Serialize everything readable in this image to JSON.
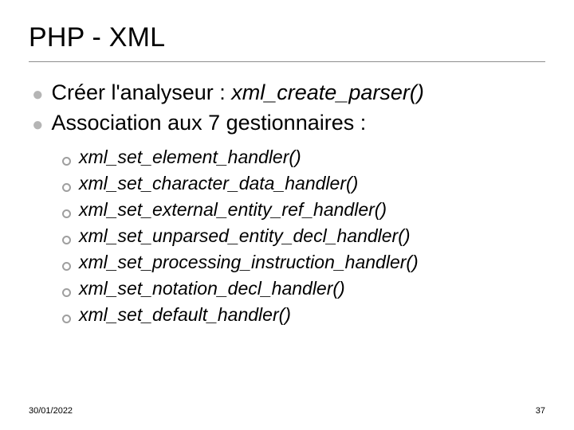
{
  "title": "PHP - XML",
  "bullets": [
    {
      "prefix": "Créer l'analyseur : ",
      "italic": "xml_create_parser()"
    },
    {
      "prefix": "Association aux 7 gestionnaires :",
      "italic": ""
    }
  ],
  "subitems": [
    "xml_set_element_handler()",
    "xml_set_character_data_handler()",
    "xml_set_external_entity_ref_handler()",
    "xml_set_unparsed_entity_decl_handler()",
    "xml_set_processing_instruction_handler()",
    "xml_set_notation_decl_handler()",
    "xml_set_default_handler()"
  ],
  "footer": {
    "date": "30/01/2022",
    "page": "37"
  }
}
